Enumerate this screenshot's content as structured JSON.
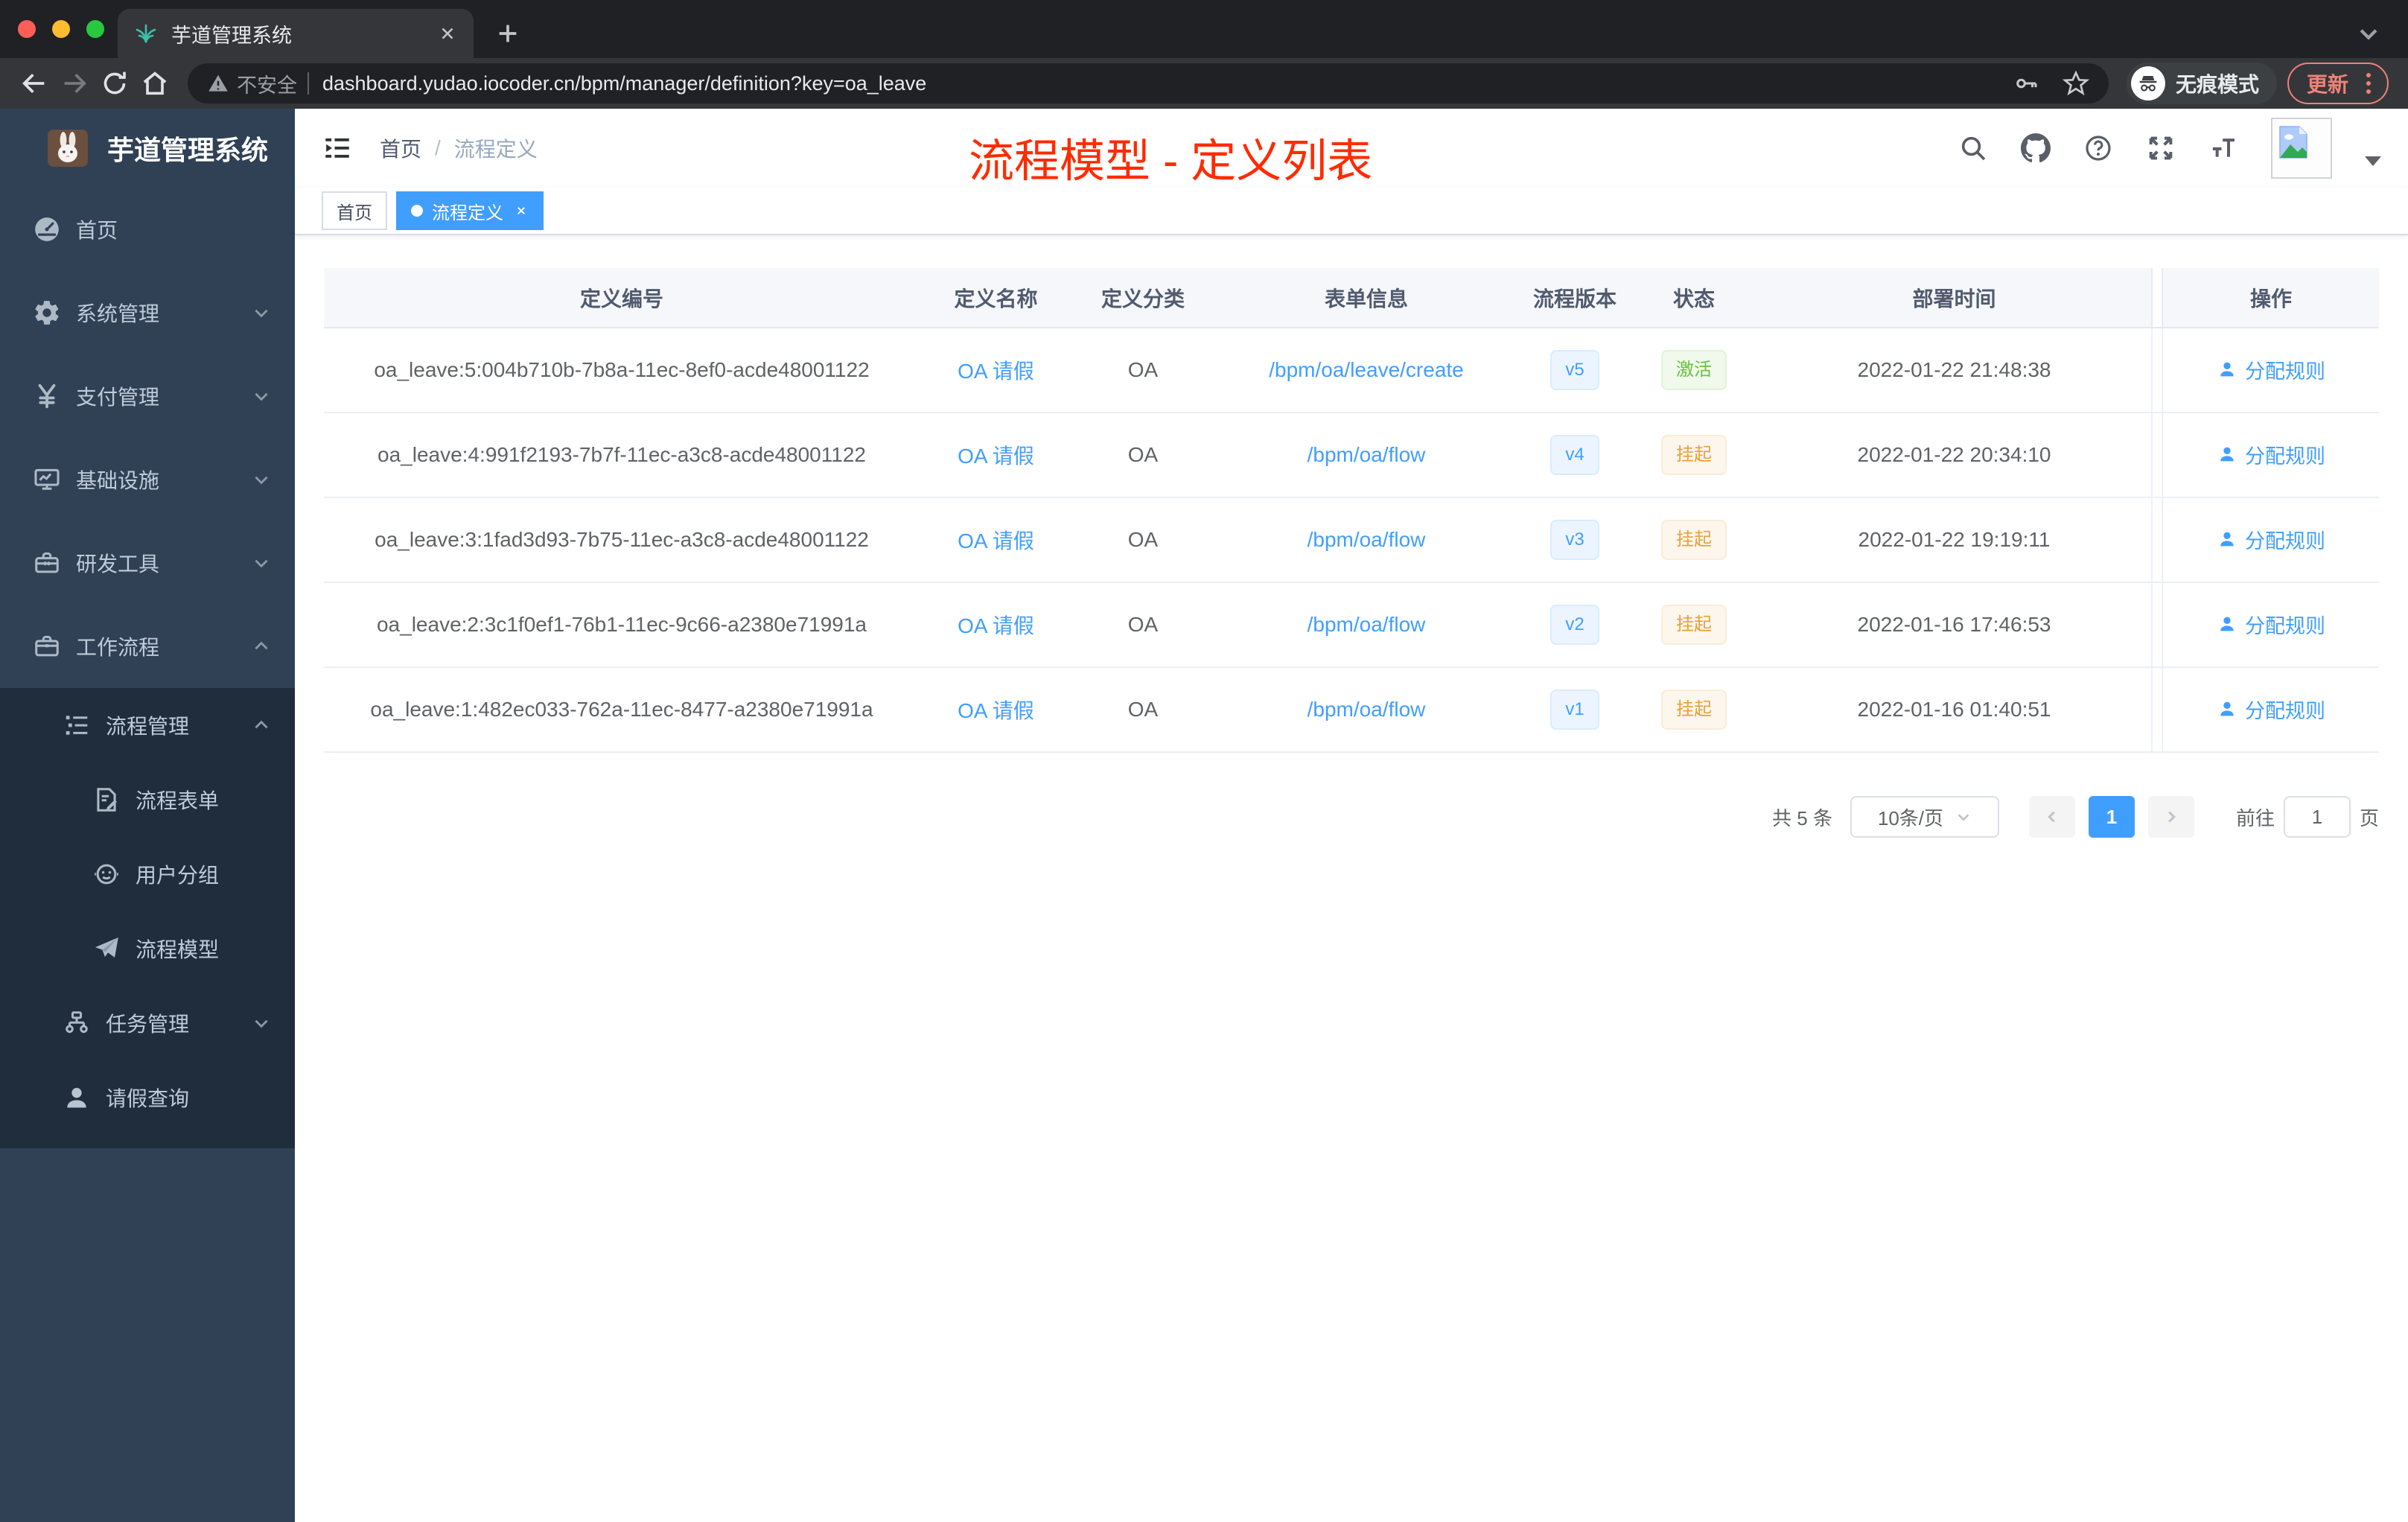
{
  "browser": {
    "tab_title": "芋道管理系统",
    "security_label": "不安全",
    "url": "dashboard.yudao.iocoder.cn/bpm/manager/definition?key=oa_leave",
    "incognito_label": "无痕模式",
    "update_label": "更新"
  },
  "sidebar": {
    "app_title": "芋道管理系统",
    "items": [
      {
        "label": "首页",
        "icon": "dashboard-icon",
        "expandable": false
      },
      {
        "label": "系统管理",
        "icon": "gear-icon",
        "expandable": true,
        "expanded": false
      },
      {
        "label": "支付管理",
        "icon": "yen-icon",
        "expandable": true,
        "expanded": false
      },
      {
        "label": "基础设施",
        "icon": "monitor-icon",
        "expandable": true,
        "expanded": false
      },
      {
        "label": "研发工具",
        "icon": "toolbox-icon",
        "expandable": true,
        "expanded": false
      },
      {
        "label": "工作流程",
        "icon": "briefcase-icon",
        "expandable": true,
        "expanded": true
      }
    ],
    "workflow_submenu": {
      "process_group": {
        "label": "流程管理",
        "icon": "tree-list-icon",
        "expanded": true
      },
      "process_items": [
        {
          "label": "流程表单",
          "icon": "form-edit-icon"
        },
        {
          "label": "用户分组",
          "icon": "robot-icon"
        },
        {
          "label": "流程模型",
          "icon": "paper-plane-icon"
        }
      ],
      "task_group": {
        "label": "任务管理",
        "icon": "org-tree-icon",
        "expanded": false
      },
      "leave_query": {
        "label": "请假查询",
        "icon": "user-icon"
      }
    }
  },
  "header": {
    "breadcrumb_home": "首页",
    "breadcrumb_separator": "/",
    "breadcrumb_current": "流程定义",
    "annotation": "流程模型 - 定义列表",
    "annotation_color": "#ff2b00",
    "action_icons": [
      "search-icon",
      "github-icon",
      "question-icon",
      "fullscreen-icon",
      "font-size-icon",
      "avatar",
      "caret-down-icon"
    ]
  },
  "tags": [
    {
      "label": "首页",
      "active": false
    },
    {
      "label": "流程定义",
      "active": true,
      "closable": true
    }
  ],
  "table": {
    "columns": [
      "定义编号",
      "定义名称",
      "定义分类",
      "表单信息",
      "流程版本",
      "状态",
      "部署时间",
      "操作"
    ],
    "rows": [
      {
        "id": "oa_leave:5:004b710b-7b8a-11ec-8ef0-acde48001122",
        "name": "OA 请假",
        "category": "OA",
        "form": "/bpm/oa/leave/create",
        "version": "v5",
        "status": "激活",
        "status_type": "success",
        "deploy_time": "2022-01-22 21:48:38",
        "action": "分配规则"
      },
      {
        "id": "oa_leave:4:991f2193-7b7f-11ec-a3c8-acde48001122",
        "name": "OA 请假",
        "category": "OA",
        "form": "/bpm/oa/flow",
        "version": "v4",
        "status": "挂起",
        "status_type": "warning",
        "deploy_time": "2022-01-22 20:34:10",
        "action": "分配规则"
      },
      {
        "id": "oa_leave:3:1fad3d93-7b75-11ec-a3c8-acde48001122",
        "name": "OA 请假",
        "category": "OA",
        "form": "/bpm/oa/flow",
        "version": "v3",
        "status": "挂起",
        "status_type": "warning",
        "deploy_time": "2022-01-22 19:19:11",
        "action": "分配规则"
      },
      {
        "id": "oa_leave:2:3c1f0ef1-76b1-11ec-9c66-a2380e71991a",
        "name": "OA 请假",
        "category": "OA",
        "form": "/bpm/oa/flow",
        "version": "v2",
        "status": "挂起",
        "status_type": "warning",
        "deploy_time": "2022-01-16 17:46:53",
        "action": "分配规则"
      },
      {
        "id": "oa_leave:1:482ec033-762a-11ec-8477-a2380e71991a",
        "name": "OA 请假",
        "category": "OA",
        "form": "/bpm/oa/flow",
        "version": "v1",
        "status": "挂起",
        "status_type": "warning",
        "deploy_time": "2022-01-16 01:40:51",
        "action": "分配规则"
      }
    ]
  },
  "pagination": {
    "total_label": "共 5 条",
    "page_size_label": "10条/页",
    "current_page": "1",
    "goto_label": "前往",
    "goto_value": "1",
    "page_unit_label": "页"
  },
  "colors": {
    "accent": "#409eff",
    "success": "#67c23a",
    "warning": "#e6a23c",
    "sidebar_bg": "#304156",
    "submenu_bg": "#1f2d3d",
    "annotation_red": "#ff2b00"
  }
}
